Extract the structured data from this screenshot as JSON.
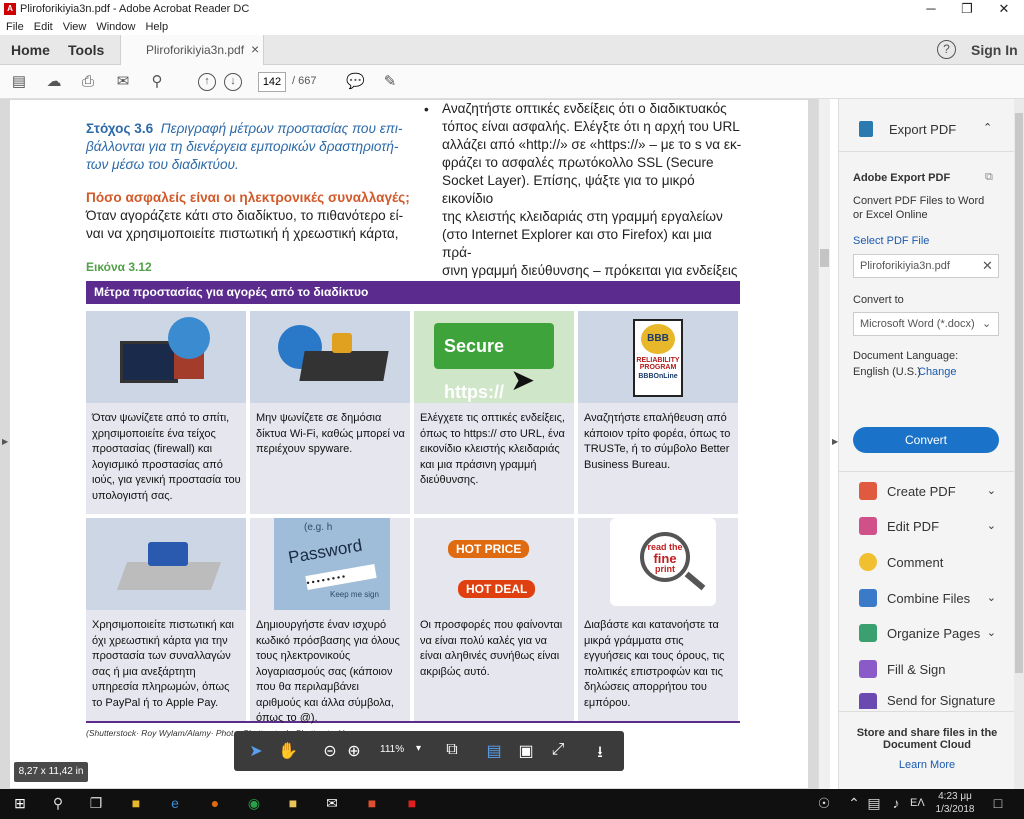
{
  "window": {
    "title": "Pliroforikiyia3n.pdf - Adobe Acrobat Reader DC",
    "minimize": "─",
    "maximize": "❐",
    "close": "✕"
  },
  "menu": [
    "File",
    "Edit",
    "View",
    "Window",
    "Help"
  ],
  "tabs": {
    "home": "Home",
    "tools": "Tools",
    "doc": "Pliroforikiyia3n.pdf",
    "doc_close": "×",
    "help": "?",
    "signin": "Sign In"
  },
  "toolbar": {
    "page_current": "142",
    "page_total": "/ 667"
  },
  "page": {
    "bullet": "•",
    "obj_num": "Στόχος 3.6",
    "obj_text": [
      "Περιγραφή μέτρων προστασίας που επι-",
      "βάλλονται για τη διενέργεια εμπορικών δραστηριοτή-",
      "των μέσω του διαδικτύου."
    ],
    "heading": "Πόσο ασφαλείς είναι οι ηλεκτρονικές συναλλαγές;",
    "left_para": [
      "Όταν αγοράζετε κάτι στο διαδίκτυο, το πιθανότερο εί-",
      "ναι να χρησιμοποιείτε πιστωτική ή χρεωστική κάρτα,"
    ],
    "right_para": [
      "Αναζητήστε οπτικές ενδείξεις ότι ο διαδικτυακός",
      "τόπος είναι ασφαλής. Ελέγξτε ότι η αρχή του URL",
      "αλλάζει από «http://» σε «https://» – με το s να εκ-",
      "φράζει το ασφαλές πρωτόκολλο SSL (Secure",
      "Socket Layer). Επίσης, ψάξτε για το μικρό εικονίδιο",
      "της κλειστής κλειδαριάς στη γραμμή εργαλείων",
      "(στο Internet Explorer και στο Firefox) και μια πρά-",
      "σινη γραμμή διεύθυνσης – πρόκειται για ενδείξεις"
    ],
    "figure_label": "Εικόνα 3.12",
    "figure_title": "Μέτρα προστασίας για αγορές από το διαδίκτυο",
    "secure_img": "Secure https://",
    "bbb_img": [
      "BBB",
      "RELIABILITY",
      "PROGRAM",
      "BBBOnLine"
    ],
    "password_img": [
      "(e.g. h",
      "Password",
      "Keep me sign"
    ],
    "hot_img": [
      "HOT PRICE",
      "HOT DEAL"
    ],
    "fine_print_img": [
      "read the",
      "fine",
      "print"
    ],
    "cells": [
      "Όταν ψωνίζετε από το σπίτι, χρησιμοποιείτε ένα τείχος προστασίας (firewall) και λογισμικό προστασίας από ιούς, για γενική προστασία του υπολογιστή σας.",
      "Μην ψωνίζετε σε δημόσια δίκτυα Wi-Fi, καθώς μπορεί να περιέχουν spyware.",
      "Ελέγχετε τις οπτικές ενδείξεις, όπως το https:// στο URL, ένα εικονίδιο κλειστής κλειδαριάς και μια πράσινη γραμμή διεύθυνσης.",
      "Αναζητήστε επαλήθευση από κάποιον τρίτο φορέα, όπως το TRUSTe, ή το σύμβολο Better Business Bureau.",
      "Χρησιμοποιείτε πιστωτική και όχι χρεωστική κάρτα για την προστασία των συναλλαγών σας ή μια ανεξάρτητη υπηρεσία πληρωμών, όπως το PayPal ή το Apple Pay.",
      "Δημιουργήστε έναν ισχυρό κωδικό πρόσβασης για όλους τους ηλεκτρονικούς λογαριασμούς σας (κάποιον που θα περιλαμβάνει αριθμούς και άλλα σύμβολα, όπως το @).",
      "Οι προσφορές που φαίνονται να είναι πολύ καλές για να είναι αληθινές συνήθως είναι ακριβώς αυτό.",
      "Διαβάστε και κατανοήστε τα μικρά γράμματα στις εγγυήσεις και τους όρους, τις πολιτικές επιστροφών και τις δηλώσεις απορρήτου του εμπόρου."
    ],
    "credit": "(Shutterstock· Roy Wylam/Alamy· Phot... Shutterstock· Shutterstock)"
  },
  "zoom": "111%",
  "size_badge": "8,27 x 11,42 in",
  "right_panel": {
    "export_pdf": "Export PDF",
    "adobe_export": "Adobe Export PDF",
    "convert_desc": [
      "Convert PDF Files to Word",
      "or Excel Online"
    ],
    "select_label": "Select PDF File",
    "file_name": "Pliroforikiyia3n.pdf",
    "convert_to_label": "Convert to",
    "convert_to_value": "Microsoft Word (*.docx)",
    "doc_lang_label": "Document Language:",
    "doc_lang_value": "English (U.S.)",
    "change": "Change",
    "convert_button": "Convert",
    "tools": [
      "Create PDF",
      "Edit PDF",
      "Comment",
      "Combine Files",
      "Organize Pages",
      "Fill & Sign",
      "Send for Signature"
    ],
    "store_text": [
      "Store and share files in the",
      "Document Cloud"
    ],
    "learn_more": "Learn More"
  },
  "taskbar": {
    "time": "4:23 μμ",
    "date": "1/3/2018",
    "lang": "ΕΛ"
  },
  "colors": {
    "accent_blue": "#1a73c9",
    "purple": "#5b2c8e",
    "green": "#52a048",
    "orange": "#d25a2a"
  }
}
